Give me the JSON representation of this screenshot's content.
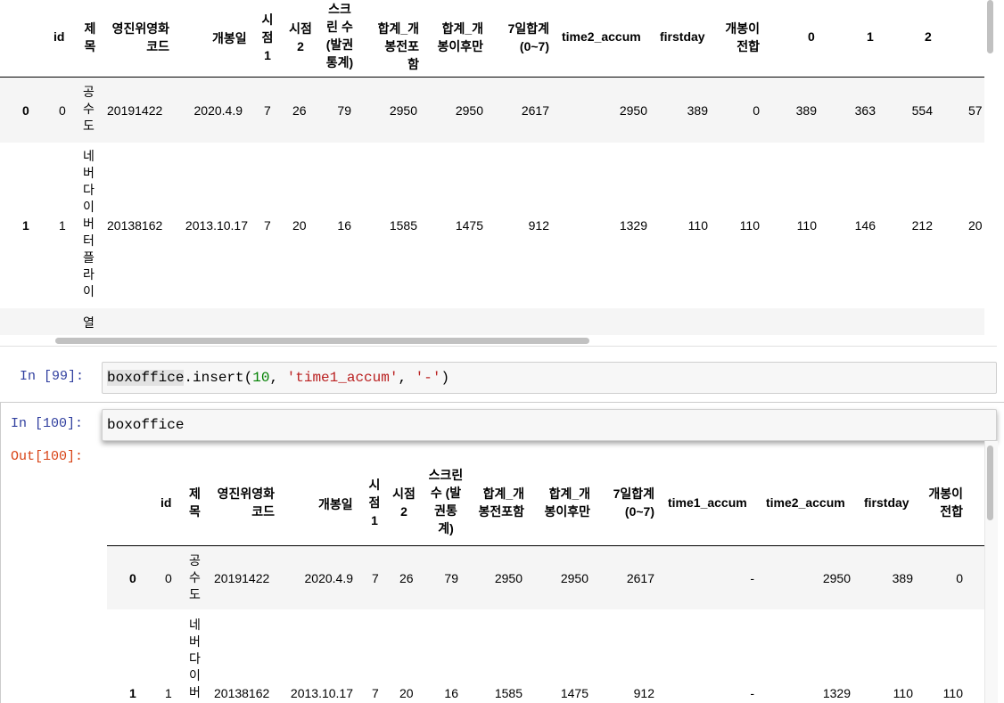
{
  "top_table": {
    "headers": [
      "id",
      "제목",
      "영진위영화코드",
      "개봉일",
      "시점1",
      "시점2",
      "스크린 수 (발권통계)",
      "합계_개봉전포함",
      "합계_개봉이후만",
      "7일합계 (0~7)",
      "time2_accum",
      "firstday",
      "개봉이전합",
      "0",
      "1",
      "2"
    ],
    "rows": [
      {
        "index": "0",
        "cells": [
          "0",
          "공수도",
          "20191422",
          "2020.4.9",
          "7",
          "26",
          "79",
          "2950",
          "2950",
          "2617",
          "2950",
          "389",
          "0",
          "389",
          "363",
          "554",
          "57"
        ]
      },
      {
        "index": "1",
        "cells": [
          "1",
          "네버다이버터플라이",
          "20138162",
          "2013.10.17",
          "7",
          "20",
          "16",
          "1585",
          "1475",
          "912",
          "1329",
          "110",
          "110",
          "110",
          "146",
          "212",
          "20"
        ]
      },
      {
        "index": "",
        "cells": [
          "",
          "열"
        ]
      }
    ]
  },
  "cell99": {
    "prompt": "In [99]:",
    "code_var": "boxoffice",
    "code_method": ".insert(",
    "code_num": "10",
    "code_sep1": ", ",
    "code_str1": "'time1_accum'",
    "code_sep2": ", ",
    "code_str2": "'-'",
    "code_end": ")"
  },
  "cell100": {
    "prompt": "In [100]:",
    "code": "boxoffice",
    "out_prompt": "Out[100]:"
  },
  "bottom_table": {
    "headers": [
      "id",
      "제목",
      "영진위영화코드",
      "개봉일",
      "시점1",
      "시점2",
      "스크린 수 (발권통계)",
      "합계_개봉전포함",
      "합계_개봉이후만",
      "7일합계 (0~7)",
      "time1_accum",
      "time2_accum",
      "firstday",
      "개봉이전합"
    ],
    "rows": [
      {
        "index": "0",
        "cells": [
          "0",
          "공수도",
          "20191422",
          "2020.4.9",
          "7",
          "26",
          "79",
          "2950",
          "2950",
          "2617",
          "-",
          "2950",
          "389",
          "0"
        ]
      },
      {
        "index": "1",
        "cells": [
          "1",
          "네버다이버",
          "20138162",
          "2013.10.17",
          "7",
          "20",
          "16",
          "1585",
          "1475",
          "912",
          "-",
          "1329",
          "110",
          "110"
        ]
      }
    ]
  }
}
